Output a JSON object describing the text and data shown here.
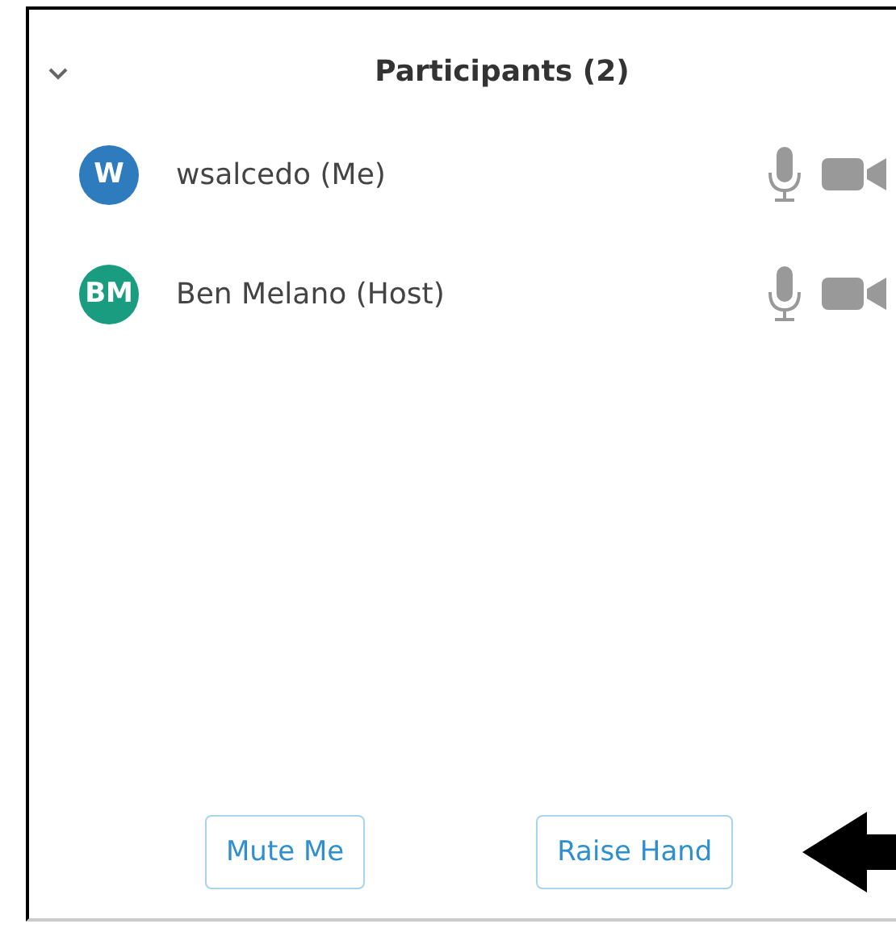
{
  "panel": {
    "title": "Participants (2)"
  },
  "participants": [
    {
      "initials": "W",
      "name": "wsalcedo (Me)",
      "color": "#2e7bbd"
    },
    {
      "initials": "BM",
      "name": "Ben Melano (Host)",
      "color": "#1a9c80"
    }
  ],
  "buttons": [
    "Mute Me",
    "Raise Hand"
  ]
}
